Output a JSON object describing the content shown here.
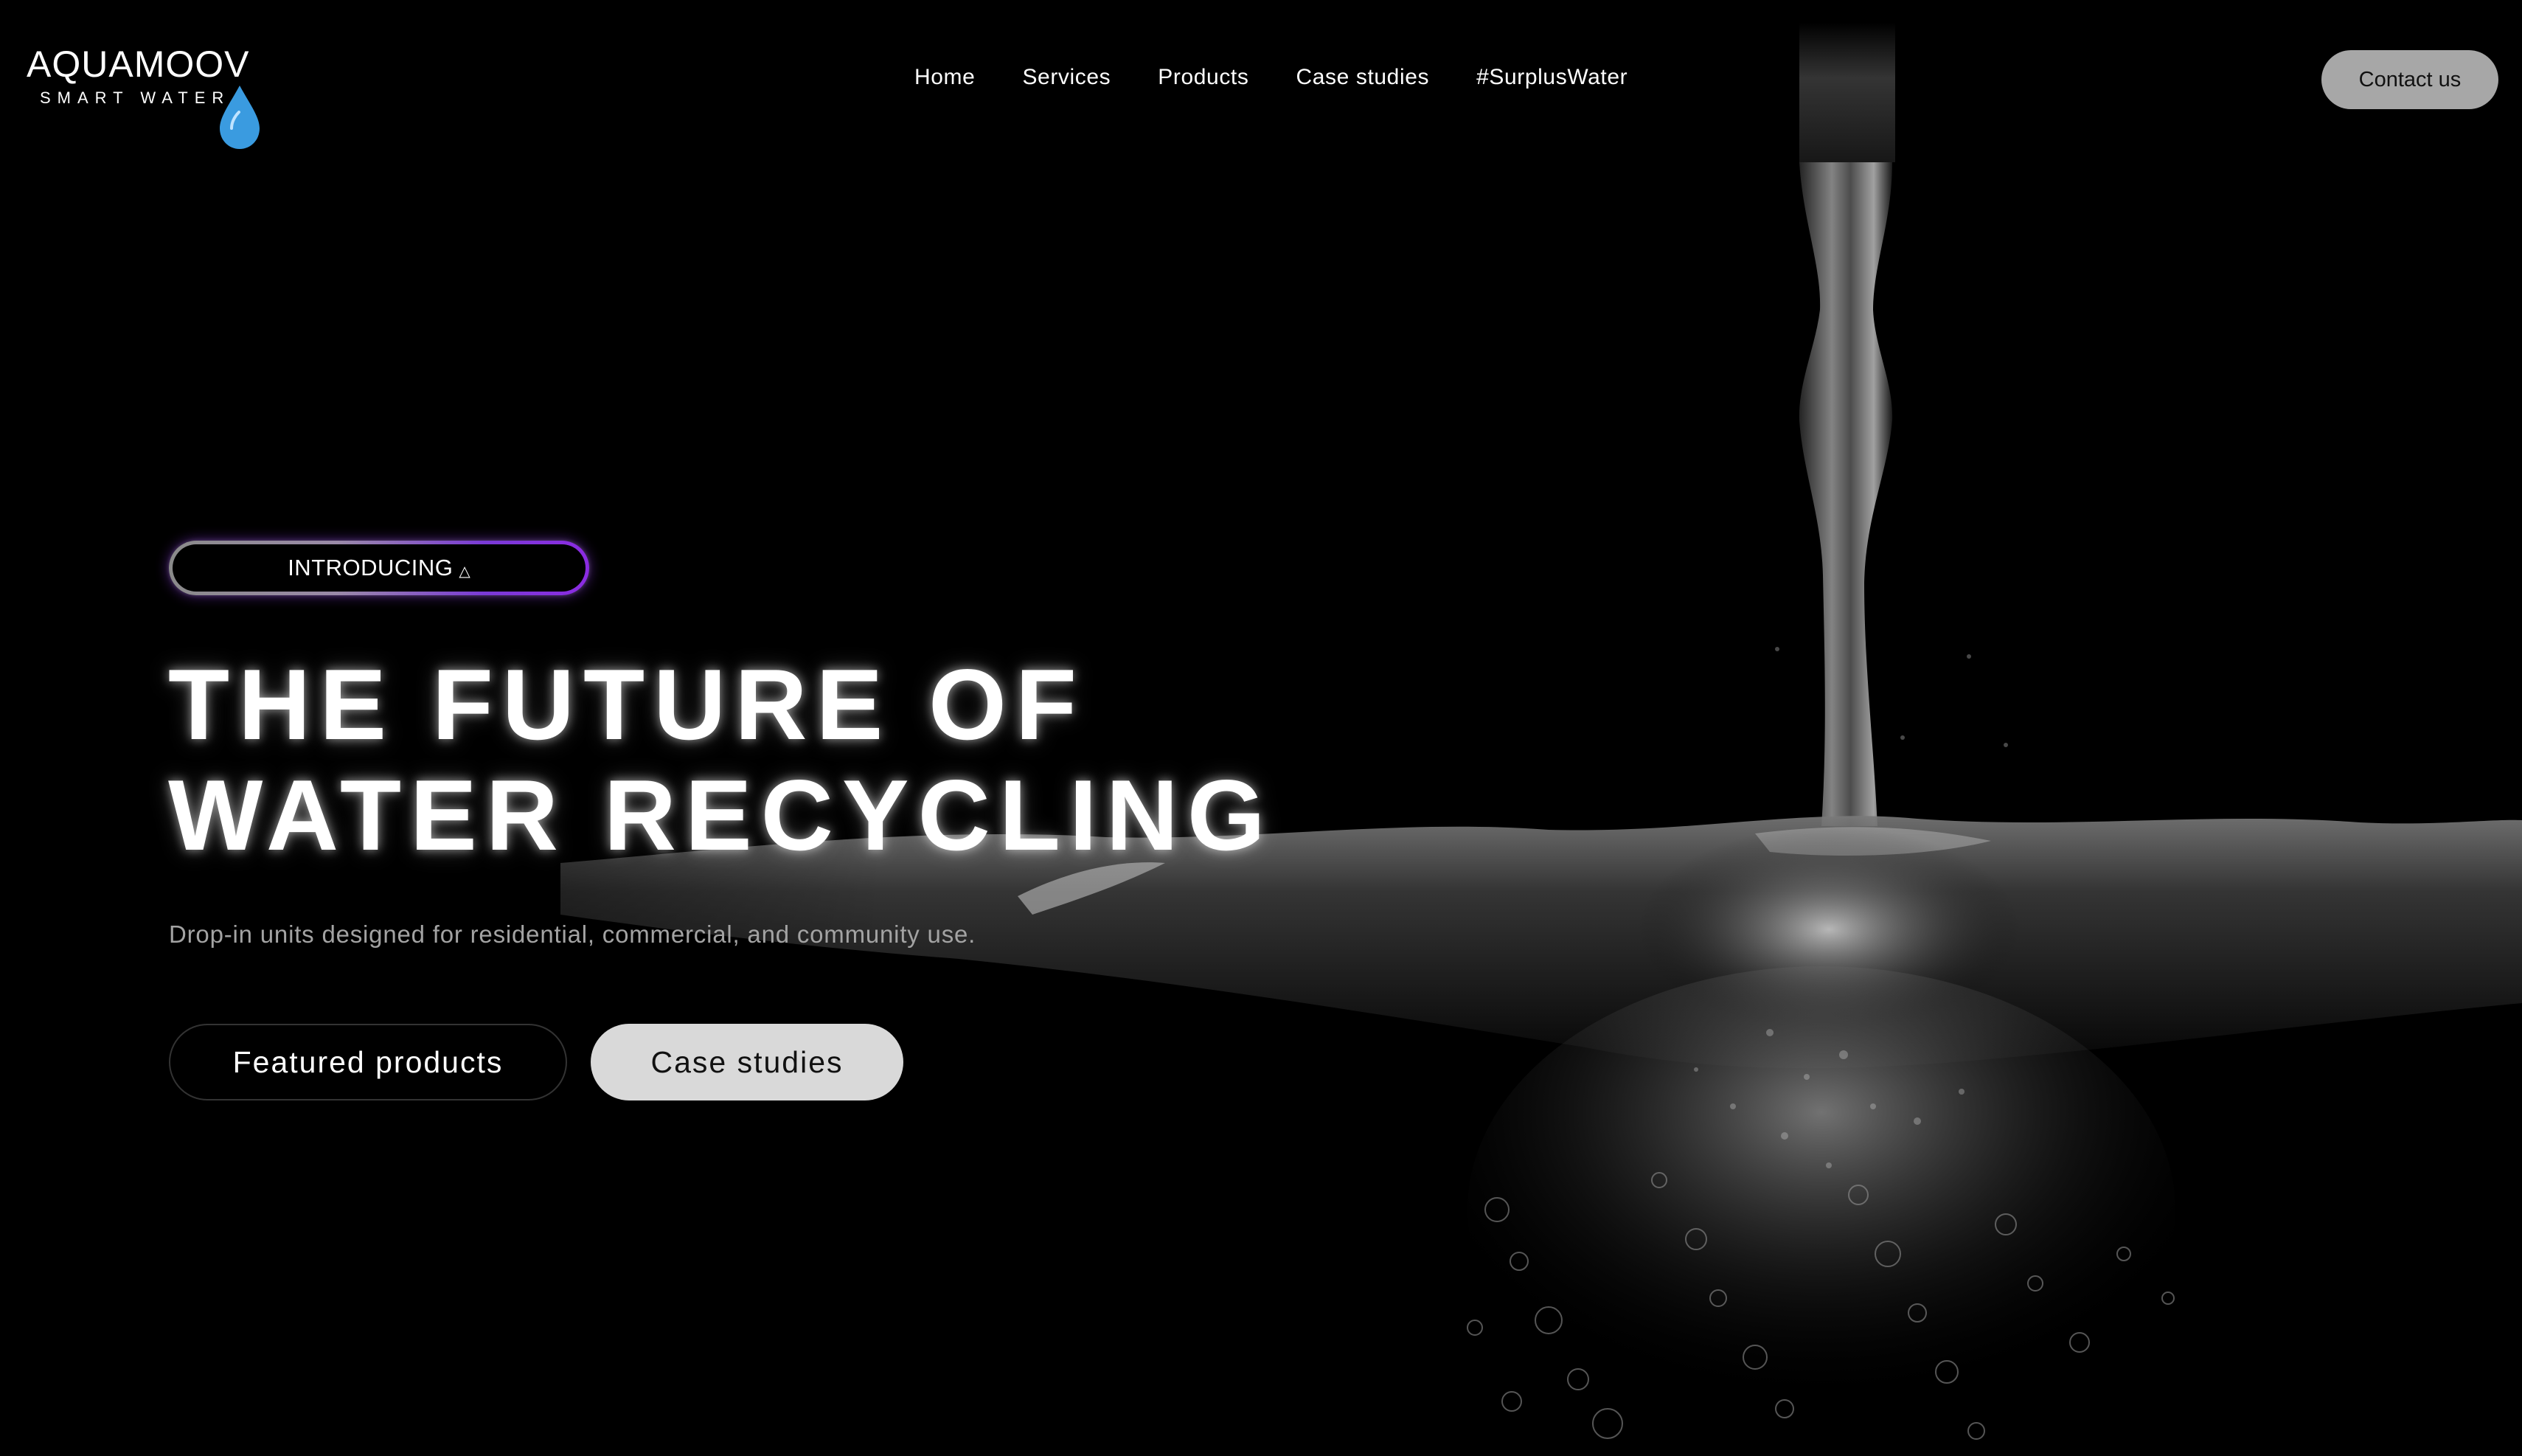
{
  "brand": {
    "name": "AQUAMOOV",
    "tagline": "SMART WATER",
    "drop_color": "#3a9be0"
  },
  "nav": {
    "items": [
      {
        "label": "Home"
      },
      {
        "label": "Services"
      },
      {
        "label": "Products"
      },
      {
        "label": "Case studies"
      },
      {
        "label": "#SurplusWater"
      }
    ],
    "contact_label": "Contact us"
  },
  "hero": {
    "badge": "INTRODUCING",
    "badge_icon": "△",
    "title_line1": "THE FUTURE OF",
    "title_line2": "WATER RECYCLING",
    "subtitle": "Drop-in units designed for residential, commercial, and community use.",
    "primary_button": "Featured products",
    "secondary_button": "Case studies"
  },
  "colors": {
    "background": "#000000",
    "badge_accent": "#8b2be2",
    "contact_bg": "#a7a7a7",
    "secondary_btn_bg": "#d9d9d9"
  }
}
